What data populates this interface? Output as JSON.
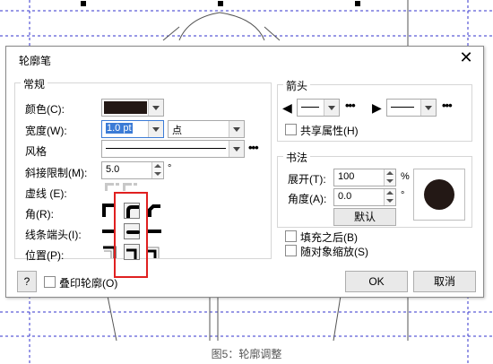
{
  "dialog": {
    "title": "轮廓笔",
    "close_glyph": "✕"
  },
  "general": {
    "group_label": "常规",
    "color_label": "颜色(C):",
    "width_label": "宽度(W):",
    "width_value": "1.0 pt",
    "unit_value": "点",
    "style_label": "风格",
    "miter_label": "斜接限制(M):",
    "miter_value": "5.0",
    "miter_unit": "°",
    "dash_label": "虚线 (E):",
    "corner_label": "角(R):",
    "cap_label": "线条端头(I):",
    "position_label": "位置(P):",
    "more_glyph": "•••",
    "pen_color": "#231815"
  },
  "arrows": {
    "group_label": "箭头",
    "share_label": "共享属性(H)",
    "more_glyph": "•••"
  },
  "calligraphy": {
    "group_label": "书法",
    "stretch_label": "展开(T):",
    "stretch_value": "100",
    "stretch_unit": "%",
    "angle_label": "角度(A):",
    "angle_value": "0.0",
    "angle_unit": "°",
    "default_button": "默认"
  },
  "options": {
    "behind_fill_label": "填充之后(B)",
    "scale_label": "随对象缩放(S)"
  },
  "footer": {
    "help_label": "?",
    "overprint_label": "叠印轮廓(O)",
    "ok_label": "OK",
    "cancel_label": "取消"
  },
  "caption": "图5：轮廓调整",
  "colors": {
    "highlight": "#e02020",
    "guide_line": "#3333cc"
  }
}
